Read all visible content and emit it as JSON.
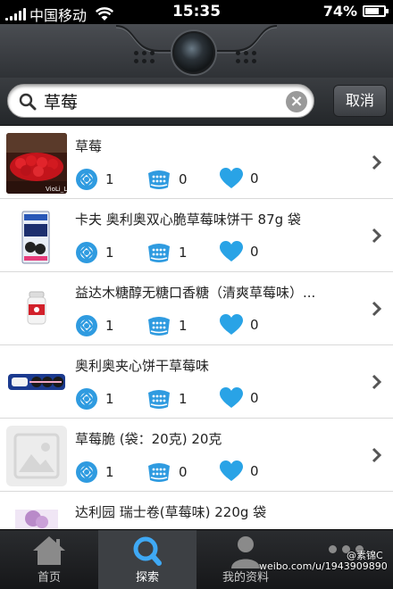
{
  "status_bar": {
    "carrier": "中国移动",
    "time": "15:35",
    "battery_text": "74%",
    "battery_level": 0.74
  },
  "search": {
    "value": "草莓",
    "cancel_label": "取消"
  },
  "items": [
    {
      "title": "草莓",
      "stat1": "1",
      "stat2": "0",
      "stat3": "0",
      "thumb_text": "VioLi_Li"
    },
    {
      "title": "卡夫 奥利奥双心脆草莓味饼干 87g 袋",
      "stat1": "1",
      "stat2": "1",
      "stat3": "0"
    },
    {
      "title": "益达木糖醇无糖口香糖（清爽草莓味）...",
      "stat1": "1",
      "stat2": "1",
      "stat3": "0"
    },
    {
      "title": "奥利奥夹心饼干草莓味",
      "stat1": "1",
      "stat2": "1",
      "stat3": "0"
    },
    {
      "title": "草莓脆 (袋：20克) 20克",
      "stat1": "1",
      "stat2": "0",
      "stat3": "0"
    },
    {
      "title": "达利园 瑞士卷(草莓味) 220g 袋",
      "stat1": "",
      "stat2": "",
      "stat3": ""
    }
  ],
  "tabs": [
    {
      "label": "首页",
      "icon": "home-icon"
    },
    {
      "label": "探索",
      "icon": "search-icon"
    },
    {
      "label": "我的资料",
      "icon": "profile-icon"
    },
    {
      "label": "",
      "icon": "more-icon"
    }
  ],
  "watermark": {
    "handle": "@素锦C",
    "url": "weibo.com/u/1943909890"
  },
  "colors": {
    "accent_blue": "#2f9be0",
    "heart_blue": "#29a3e6",
    "tab_active": "#3d4044"
  }
}
